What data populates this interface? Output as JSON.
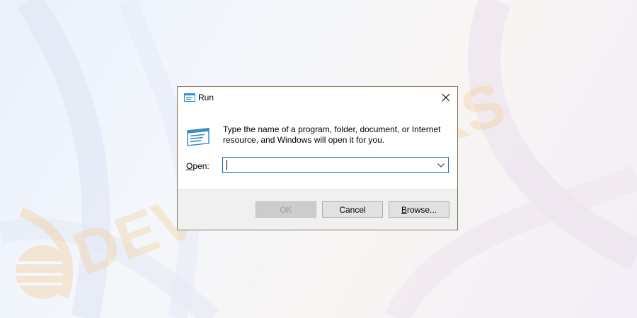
{
  "window": {
    "title": "Run",
    "close_glyph": "✕"
  },
  "dialog": {
    "description": "Type the name of a program, folder, document, or Internet resource, and Windows will open it for you.",
    "open_label_access_key": "O",
    "open_label_rest": "pen:",
    "open_value": "",
    "open_placeholder": ""
  },
  "buttons": {
    "ok_label": "OK",
    "cancel_label": "Cancel",
    "browse_access_key": "B",
    "browse_rest": "rowse..."
  },
  "watermark": {
    "text": "DEVICETRICKS"
  },
  "icons": {
    "title": "run-icon",
    "program": "run-program-icon",
    "close": "close-icon",
    "dropdown": "chevron-down-icon"
  },
  "colors": {
    "dialog_border": "#8a7a5c",
    "input_border": "#0a68c4",
    "footer_bg": "#f0f0f0",
    "button_bg": "#e1e1e1",
    "watermark": "#f6c98a"
  }
}
